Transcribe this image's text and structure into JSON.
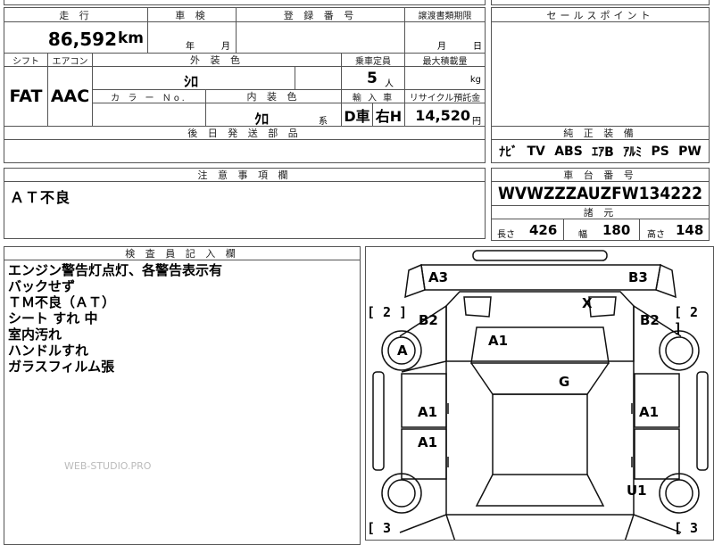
{
  "header": {
    "mileage_label": "走 行",
    "inspection_label": "車 検",
    "registration_label": "登 録 番 号",
    "transfer_label": "譲渡書類期限",
    "sales_point_label": "セールスポイント"
  },
  "row1": {
    "mileage_value": "86,592",
    "mileage_unit": "km",
    "year_unit": "年",
    "month_unit": "月",
    "transfer_month": "月",
    "transfer_day": "日"
  },
  "row2": {
    "shift_label": "シフト",
    "ac_label": "エアコン",
    "exterior_label": "外 装 色",
    "capacity_label": "乗車定員",
    "loadcap_label": "最大積載量",
    "shift_value": "FAT",
    "ac_value": "AAC",
    "exterior_value": "ｼﾛ",
    "capacity_value": "5",
    "capacity_unit": "人",
    "load_unit": "kg"
  },
  "row3": {
    "color_no_label": "カ ラ ー Ｎo.",
    "interior_label": "内 装 色",
    "import_label": "輸 入 車",
    "recycle_label": "リサイクル預託金",
    "interior_value": "ｸﾛ",
    "interior_suffix": "系",
    "import_dealer": "D車",
    "import_steering": "右H",
    "recycle_value": "14,520",
    "recycle_unit": "円"
  },
  "later_parts_label": "後 日 発 送 部 品",
  "equipment": {
    "label": "純 正 装 備",
    "items": [
      "ﾅﾋﾞ",
      "TV",
      "ABS",
      "ｴｱB",
      "ｱﾙﾐ",
      "PS",
      "PW"
    ]
  },
  "caution": {
    "label": "注 意 事 項 欄",
    "text": "ＡＴ不良"
  },
  "chassis": {
    "label": "車 台 番 号",
    "value": "WVWZZZAUZFW134222"
  },
  "specs": {
    "label": "諸 元",
    "length_label": "長さ",
    "length_value": "426",
    "width_label": "幅",
    "width_value": "180",
    "height_label": "高さ",
    "height_value": "148"
  },
  "inspector": {
    "label": "検 査 員 記 入 欄",
    "lines": [
      "エンジン警告灯点灯、各警告表示有",
      "バックせず",
      "ＴＭ不良（ＡＴ）",
      "シート すれ 中",
      "室内汚れ",
      "ハンドルすれ",
      "ガラスフィルム張"
    ]
  },
  "watermark": "WEB-STUDIO.PRO",
  "diagram": {
    "front_left_mark": "A3",
    "front_right_mark": "B3",
    "windshield_mark": "X",
    "left_fender_mark": "B2",
    "right_fender_mark": "B2",
    "left_wheel_mark": "A",
    "hood_mark": "A1",
    "roof_mark": "G",
    "left_front_door_mark": "A1",
    "right_front_door_mark": "A1",
    "left_rear_door_mark": "A1",
    "right_rear_wheel_mark": "U1",
    "left_bracket_top": "[ 2 ]",
    "right_bracket_top": "[ 2 ]",
    "left_bracket_bottom": "[ 3",
    "right_bracket_bottom": "[ 3"
  }
}
